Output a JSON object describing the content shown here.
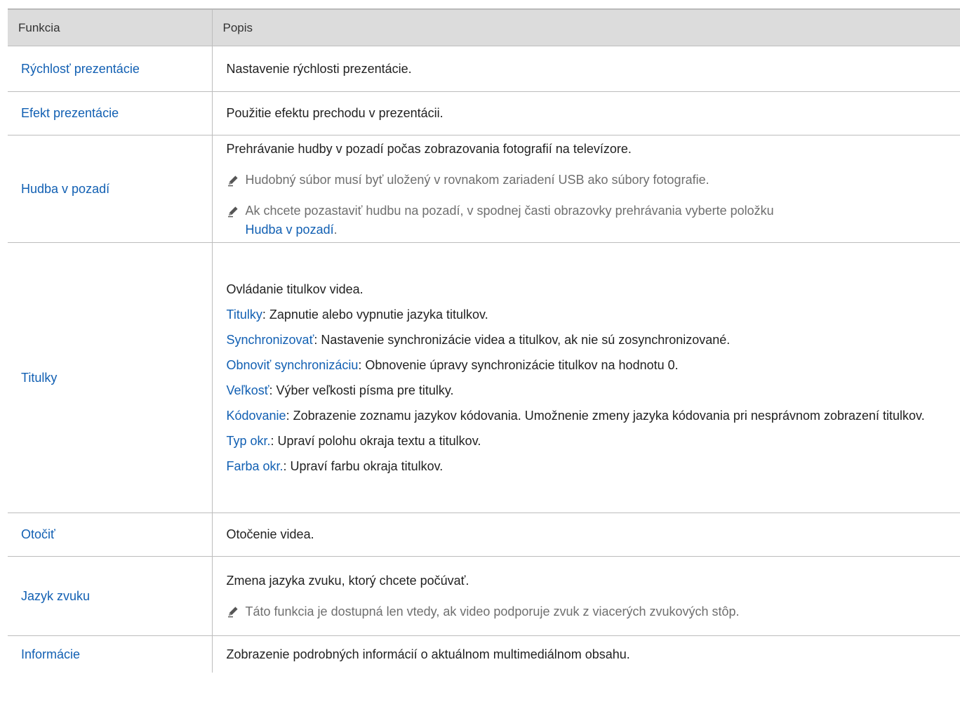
{
  "header": {
    "col_feature": "Funkcia",
    "col_description": "Popis"
  },
  "rows": {
    "slideshow_speed": {
      "feature": "Rýchlosť prezentácie",
      "description": "Nastavenie rýchlosti prezentácie."
    },
    "slideshow_effect": {
      "feature": "Efekt prezentácie",
      "description": "Použitie efektu prechodu v prezentácii."
    },
    "background_music": {
      "feature": "Hudba v pozadí",
      "description": "Prehrávanie hudby v pozadí počas zobrazovania fotografií na televízore.",
      "note1": "Hudobný súbor musí byť uložený v rovnakom zariadení USB ako súbory fotografie.",
      "note2": "Ak chcete pozastaviť hudbu na pozadí, v spodnej časti obrazovky prehrávania vyberte položku",
      "note2_link": "Hudba v pozadí",
      "note2_end": "."
    },
    "subtitles": {
      "feature": "Titulky",
      "description": "Ovládanie titulkov videa.",
      "items": [
        {
          "term": "Titulky",
          "text": ": Zapnutie alebo vypnutie jazyka titulkov."
        },
        {
          "term": "Synchronizovať",
          "text": ": Nastavenie synchronizácie videa a titulkov, ak nie sú zosynchronizované."
        },
        {
          "term": "Obnoviť synchronizáciu",
          "text": ": Obnovenie úpravy synchronizácie titulkov na hodnotu 0."
        },
        {
          "term": "Veľkosť",
          "text": ": Výber veľkosti písma pre titulky."
        },
        {
          "term": "Kódovanie",
          "text": ": Zobrazenie zoznamu jazykov kódovania. Umožnenie zmeny jazyka kódovania pri nesprávnom zobrazení titulkov."
        },
        {
          "term": "Typ okr.",
          "text": ": Upraví polohu okraja textu a titulkov."
        },
        {
          "term": "Farba okr.",
          "text": ": Upraví farbu okraja titulkov."
        }
      ]
    },
    "rotate": {
      "feature": "Otočiť",
      "description": "Otočenie videa."
    },
    "audio_language": {
      "feature": "Jazyk zvuku",
      "description": "Zmena jazyka zvuku, ktorý chcete počúvať.",
      "note1": "Táto funkcia je dostupná len vtedy, ak video podporuje zvuk z viacerých zvukových stôp."
    },
    "information": {
      "feature": "Informácie",
      "description": "Zobrazenie podrobných informácií o aktuálnom multimediálnom obsahu."
    }
  },
  "icons": {
    "note_icon": "pencil-note-icon"
  },
  "colors": {
    "link_blue": "#1260b3",
    "header_bg": "#dcdcdc",
    "note_gray": "#6f6f6f"
  }
}
